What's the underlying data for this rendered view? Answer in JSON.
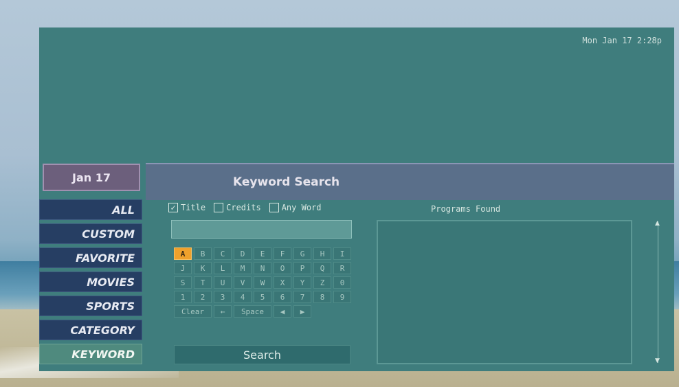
{
  "status": {
    "clock": "Mon Jan 17  2:28p"
  },
  "header": {
    "date": "Jan 17",
    "title": "Keyword Search"
  },
  "sidebar": {
    "items": [
      "ALL",
      "CUSTOM",
      "FAVORITE",
      "MOVIES",
      "SPORTS",
      "CATEGORY",
      "KEYWORD"
    ]
  },
  "options": {
    "title": "Title",
    "credits": "Credits",
    "any_word": "Any Word"
  },
  "keyboard": {
    "rows": [
      [
        "A",
        "B",
        "C",
        "D",
        "E",
        "F",
        "G",
        "H",
        "I"
      ],
      [
        "J",
        "K",
        "L",
        "M",
        "N",
        "O",
        "P",
        "Q",
        "R"
      ],
      [
        "S",
        "T",
        "U",
        "V",
        "W",
        "X",
        "Y",
        "Z",
        "0"
      ],
      [
        "1",
        "2",
        "3",
        "4",
        "5",
        "6",
        "7",
        "8",
        "9"
      ]
    ],
    "clear": "Clear",
    "backspace": "←",
    "space": "Space",
    "left": "◀",
    "right": "▶",
    "search": "Search"
  },
  "results": {
    "label": "Programs Found"
  },
  "colors": {
    "selected_key": "#efa12c",
    "panel": "#3f7d7d"
  }
}
